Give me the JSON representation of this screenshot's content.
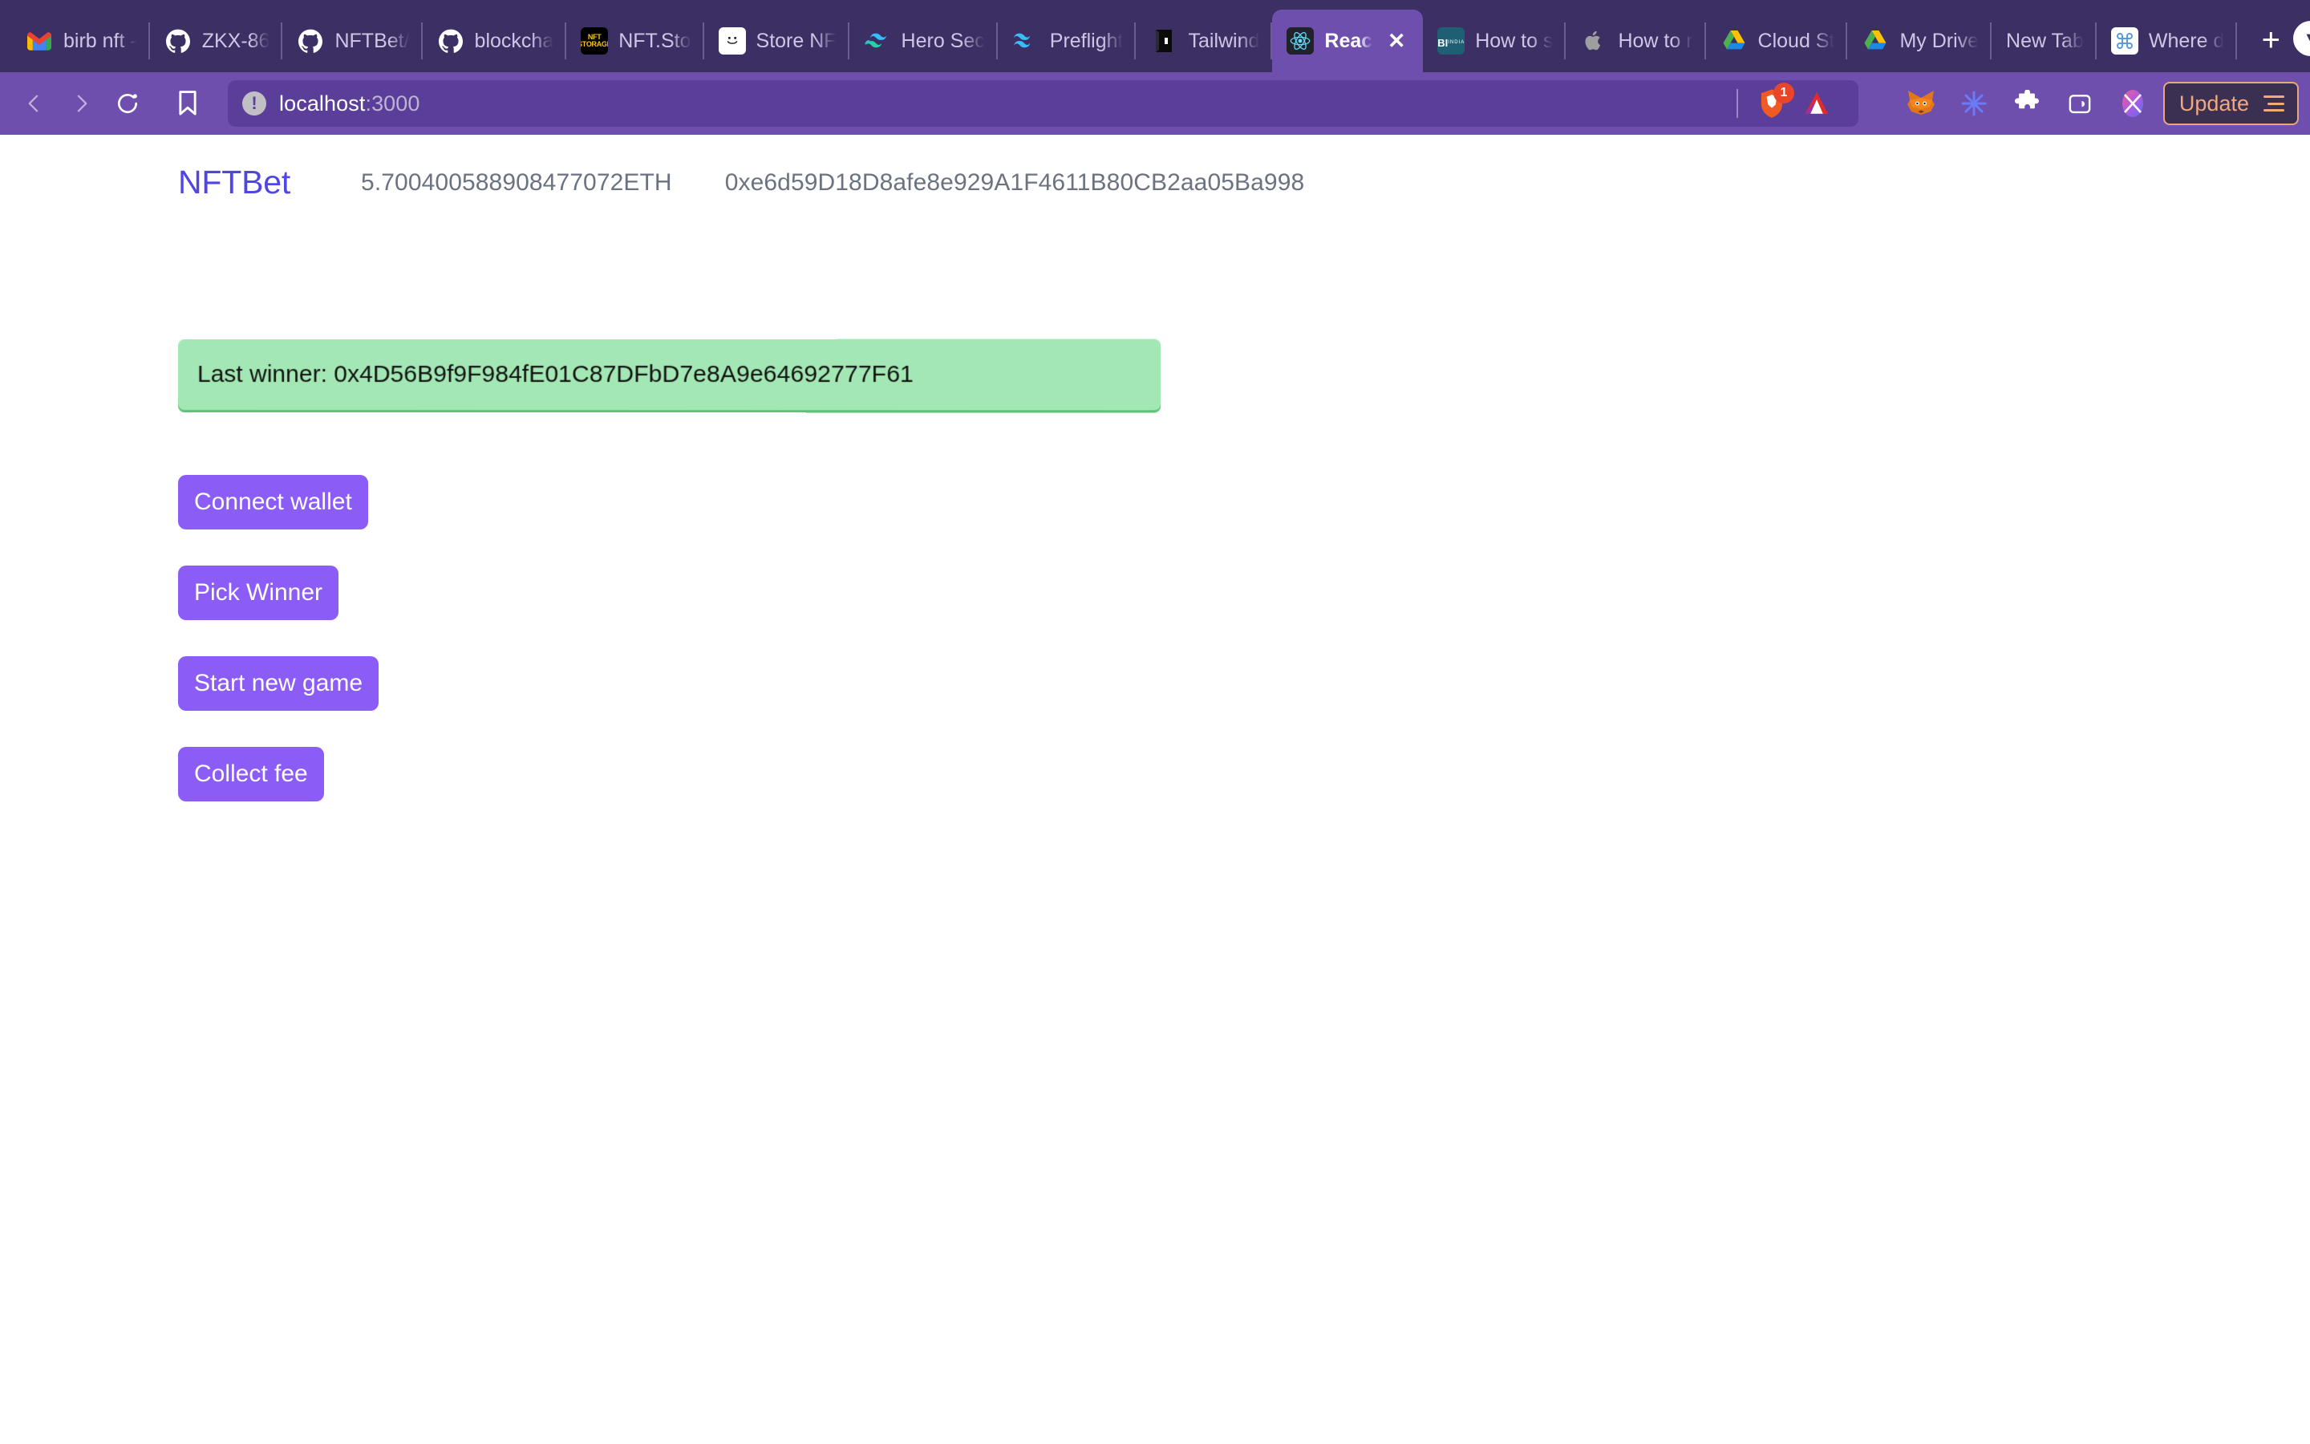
{
  "browser": {
    "tabs": [
      {
        "title": "birb nft -",
        "favicon": "gmail-icon",
        "active": false
      },
      {
        "title": "ZKX-86",
        "favicon": "github-icon",
        "active": false
      },
      {
        "title": "NFTBet/",
        "favicon": "github-icon",
        "active": false
      },
      {
        "title": "blockcha",
        "favicon": "github-icon",
        "active": false
      },
      {
        "title": "NFT.Sto",
        "favicon": "nft-storage-icon",
        "active": false
      },
      {
        "title": "Store NF",
        "favicon": "smiley-icon",
        "active": false
      },
      {
        "title": "Hero Sec",
        "favicon": "tailwind-icon",
        "active": false
      },
      {
        "title": "Preflight",
        "favicon": "tailwind-icon",
        "active": false
      },
      {
        "title": "Tailwind",
        "favicon": "book-icon",
        "active": false
      },
      {
        "title": "Reac",
        "favicon": "react-icon",
        "active": true
      },
      {
        "title": "How to s",
        "favicon": "business-insider-icon",
        "active": false
      },
      {
        "title": "How to r",
        "favicon": "apple-icon",
        "active": false
      },
      {
        "title": "Cloud St",
        "favicon": "google-drive-icon",
        "active": false
      },
      {
        "title": "My Drive",
        "favicon": "google-drive-icon",
        "active": false
      },
      {
        "title": "New Tab",
        "favicon": "none",
        "active": false
      },
      {
        "title": "Where d",
        "favicon": "command-icon",
        "active": false
      }
    ],
    "tab_close_label": "✕",
    "new_tab_label": "+",
    "tab_list_label": "▼",
    "toolbar": {
      "back_label": "back-arrow",
      "forward_label": "forward-arrow",
      "reload_label": "reload-arrow",
      "bookmark_label": "bookmark",
      "url": "localhost",
      "url_port": ":3000",
      "site_info_label": "!",
      "shield_badge": "1",
      "update_label": "Update"
    }
  },
  "page": {
    "header": {
      "logo": "NFTBet",
      "balance": "5.700400588908477072ETH",
      "address": "0xe6d59D18D8afe8e929A1F4611B80CB2aa05Ba998"
    },
    "winner_banner": {
      "text": "Last winner: 0x4D56B9f9F984fE01C87DFbD7e8A9e64692777F61",
      "background_color": "#A3E8B4"
    },
    "buttons": {
      "connect_wallet": "Connect wallet",
      "pick_winner": "Pick Winner",
      "start_new_game": "Start new game",
      "collect_fee": "Collect fee",
      "background_color": "#8B5CF6"
    }
  },
  "colors": {
    "tab_strip": "#3B2F63",
    "toolbar": "#6E4FAE",
    "logo": "#5046E4",
    "accent_update": "#F0A97F"
  }
}
